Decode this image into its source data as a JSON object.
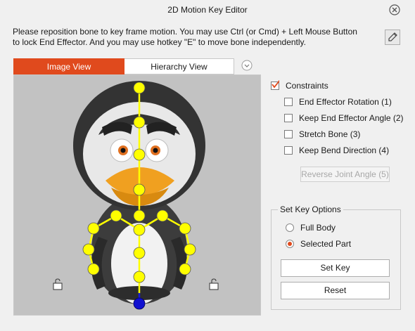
{
  "window": {
    "title": "2D Motion Key Editor"
  },
  "instructions": {
    "line1": "Please reposition bone to key frame motion. You may use Ctrl (or Cmd) + Left Mouse Button",
    "line2": "to lock End Effector. And you may use hotkey \"E\" to move bone independently."
  },
  "tabs": {
    "image_view": "Image View",
    "hierarchy_view": "Hierarchy View",
    "active": "Image View"
  },
  "constraints": {
    "label": "Constraints",
    "checked": true,
    "options": [
      {
        "label": "End Effector Rotation (1)",
        "checked": false
      },
      {
        "label": "Keep End Effector Angle (2)",
        "checked": false
      },
      {
        "label": "Stretch Bone (3)",
        "checked": false
      },
      {
        "label": "Keep Bend Direction (4)",
        "checked": false
      }
    ],
    "reverse_button": "Reverse Joint Angle (5)"
  },
  "set_key_options": {
    "legend": "Set Key Options",
    "options": [
      {
        "label": "Full Body",
        "selected": false
      },
      {
        "label": "Selected Part",
        "selected": true
      }
    ],
    "set_key_button": "Set Key",
    "reset_button": "Reset"
  },
  "icons": {
    "close": "close-icon",
    "picker": "eyedropper-icon",
    "tab_more": "chevron-down-icon",
    "lock": "lock-icon"
  },
  "colors": {
    "accent": "#e04a1d",
    "joint": "#ffff00",
    "root_joint": "#0a0ac8",
    "bone": "#ffff00"
  }
}
